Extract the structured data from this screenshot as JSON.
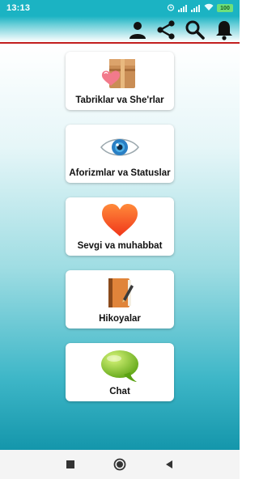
{
  "status_bar": {
    "time": "13:13",
    "battery": "100",
    "icons": [
      "alarm-icon",
      "signal-icon",
      "signal-icon",
      "wifi-icon",
      "battery-icon"
    ]
  },
  "toolbar": {
    "icons": [
      "person-icon",
      "share-icon",
      "search-icon",
      "bell-icon"
    ]
  },
  "menu": {
    "items": [
      {
        "label": "Tabriklar va She'rlar",
        "icon": "gift-box-heart-icon"
      },
      {
        "label": "Aforizmlar va Statuslar",
        "icon": "eye-icon"
      },
      {
        "label": "Sevgi va muhabbat",
        "icon": "heart-icon"
      },
      {
        "label": "Hikoyalar",
        "icon": "notebook-pencil-icon"
      },
      {
        "label": "Chat",
        "icon": "chat-bubble-icon"
      }
    ]
  },
  "nav_bar": {
    "icons": [
      "recents-square-icon",
      "home-circle-icon",
      "back-triangle-icon"
    ]
  },
  "colors": {
    "accent": "#1bb3c3",
    "divider": "#c21f1f",
    "card_text": "#111111"
  }
}
